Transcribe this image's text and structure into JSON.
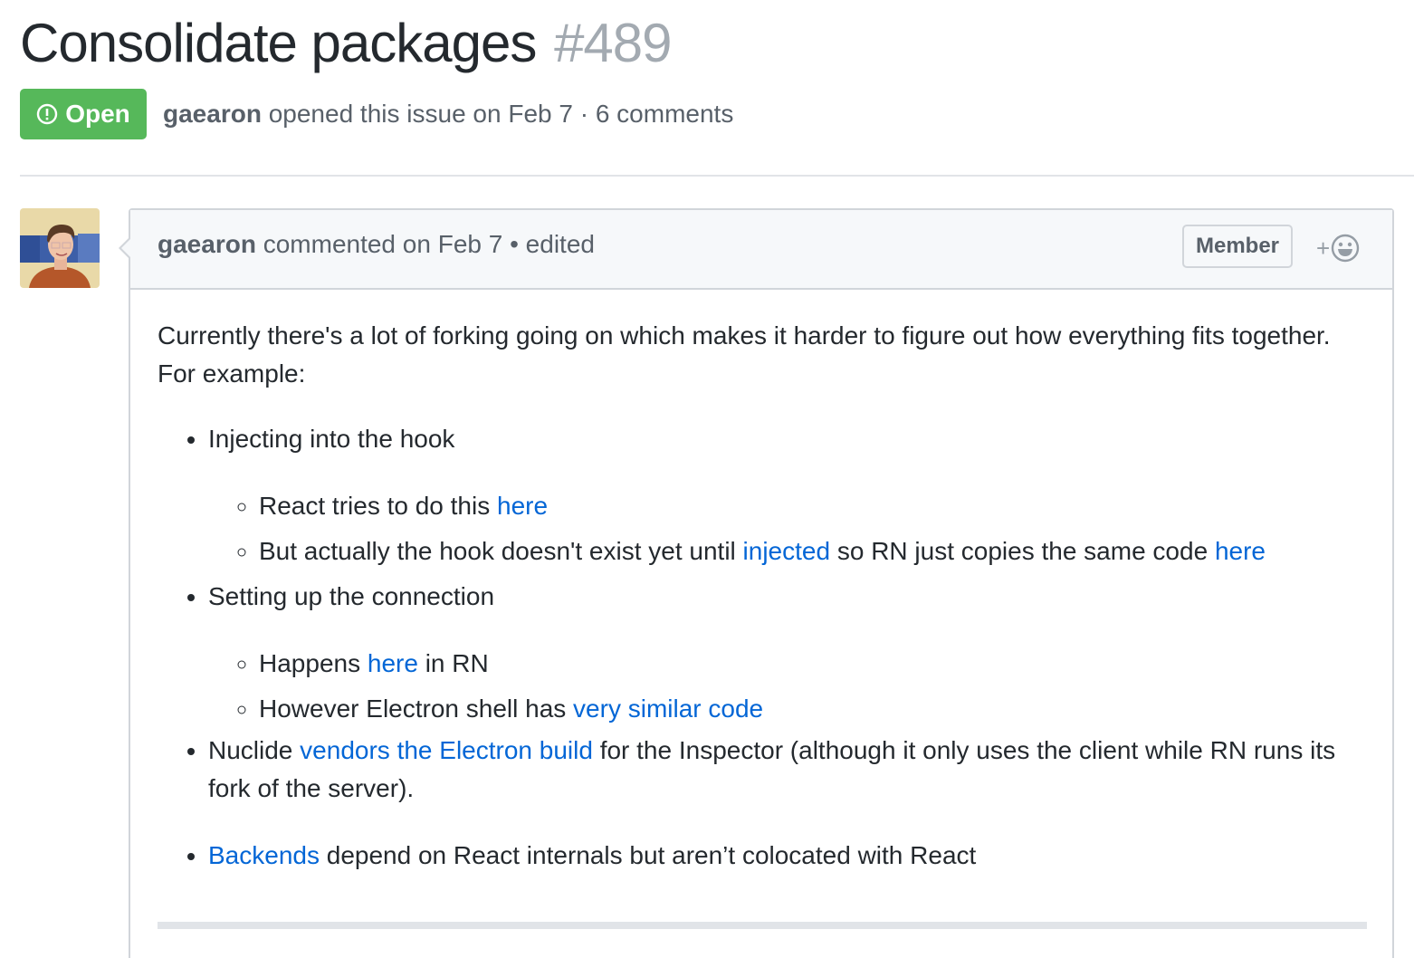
{
  "issue": {
    "title": "Consolidate packages",
    "number": "#489",
    "state_label": "Open",
    "state_color": "#56b85a",
    "author": "gaearon",
    "meta_text": " opened this issue on Feb 7 · 6 comments"
  },
  "comment": {
    "author": "gaearon",
    "header_text": " commented on Feb 7 • edited",
    "badge": "Member",
    "reaction_plus": "+",
    "intro": "Currently there's a lot of forking going on which makes it harder to figure out how everything fits together. For example:",
    "items": [
      {
        "text": "Injecting into the hook",
        "subitems": [
          {
            "pre": "React tries to do this ",
            "link": "here",
            "post": ""
          },
          {
            "pre": "But actually the hook doesn't exist yet until ",
            "link": "injected",
            "mid": " so RN just copies the same code ",
            "link2": "here"
          }
        ]
      },
      {
        "text": "Setting up the connection",
        "subitems": [
          {
            "pre": "Happens ",
            "link": "here",
            "post": " in RN"
          },
          {
            "pre": "However Electron shell has ",
            "link": "very similar code",
            "post": ""
          }
        ]
      },
      {
        "pre": "Nuclide ",
        "link": "vendors the Electron build",
        "post": " for the Inspector (although it only uses the client while RN runs its fork of the server)."
      },
      {
        "link": "Backends",
        "post": " depend on React internals but aren’t colocated with React"
      }
    ]
  },
  "colors": {
    "link": "#0366d6",
    "muted": "#586069",
    "number": "#a3aab1"
  }
}
